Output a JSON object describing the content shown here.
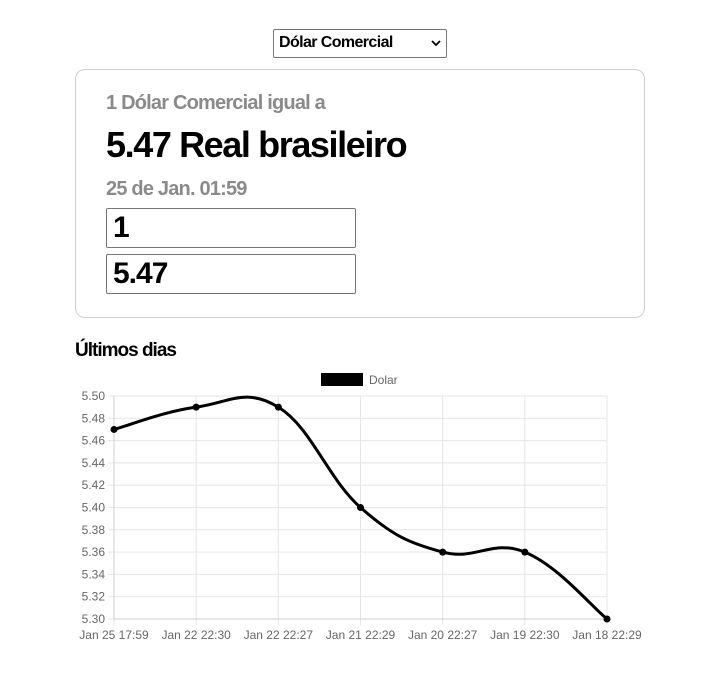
{
  "currency_select": {
    "selected": "Dólar Comercial"
  },
  "card": {
    "subtitle": "1 Dólar Comercial igual a",
    "value_line": "5.47 Real brasileiro",
    "date_line": "25 de Jan. 01:59",
    "input_from": "1",
    "input_to": "5.47"
  },
  "section_title": "Últimos dias",
  "chart_data": {
    "type": "line",
    "categories": [
      "Jan 25 17:59",
      "Jan 22 22:30",
      "Jan 22 22:27",
      "Jan 21 22:29",
      "Jan 20 22:27",
      "Jan 19 22:30",
      "Jan 18 22:29"
    ],
    "series": [
      {
        "name": "Dolar",
        "values": [
          5.47,
          5.49,
          5.49,
          5.4,
          5.36,
          5.36,
          5.3
        ]
      }
    ],
    "yticks": [
      "5.50",
      "5.48",
      "5.46",
      "5.44",
      "5.42",
      "5.40",
      "5.38",
      "5.36",
      "5.34",
      "5.32",
      "5.30"
    ],
    "ylim": [
      5.3,
      5.5
    ],
    "line_color": "#000000",
    "grid": true,
    "legend": "top"
  }
}
